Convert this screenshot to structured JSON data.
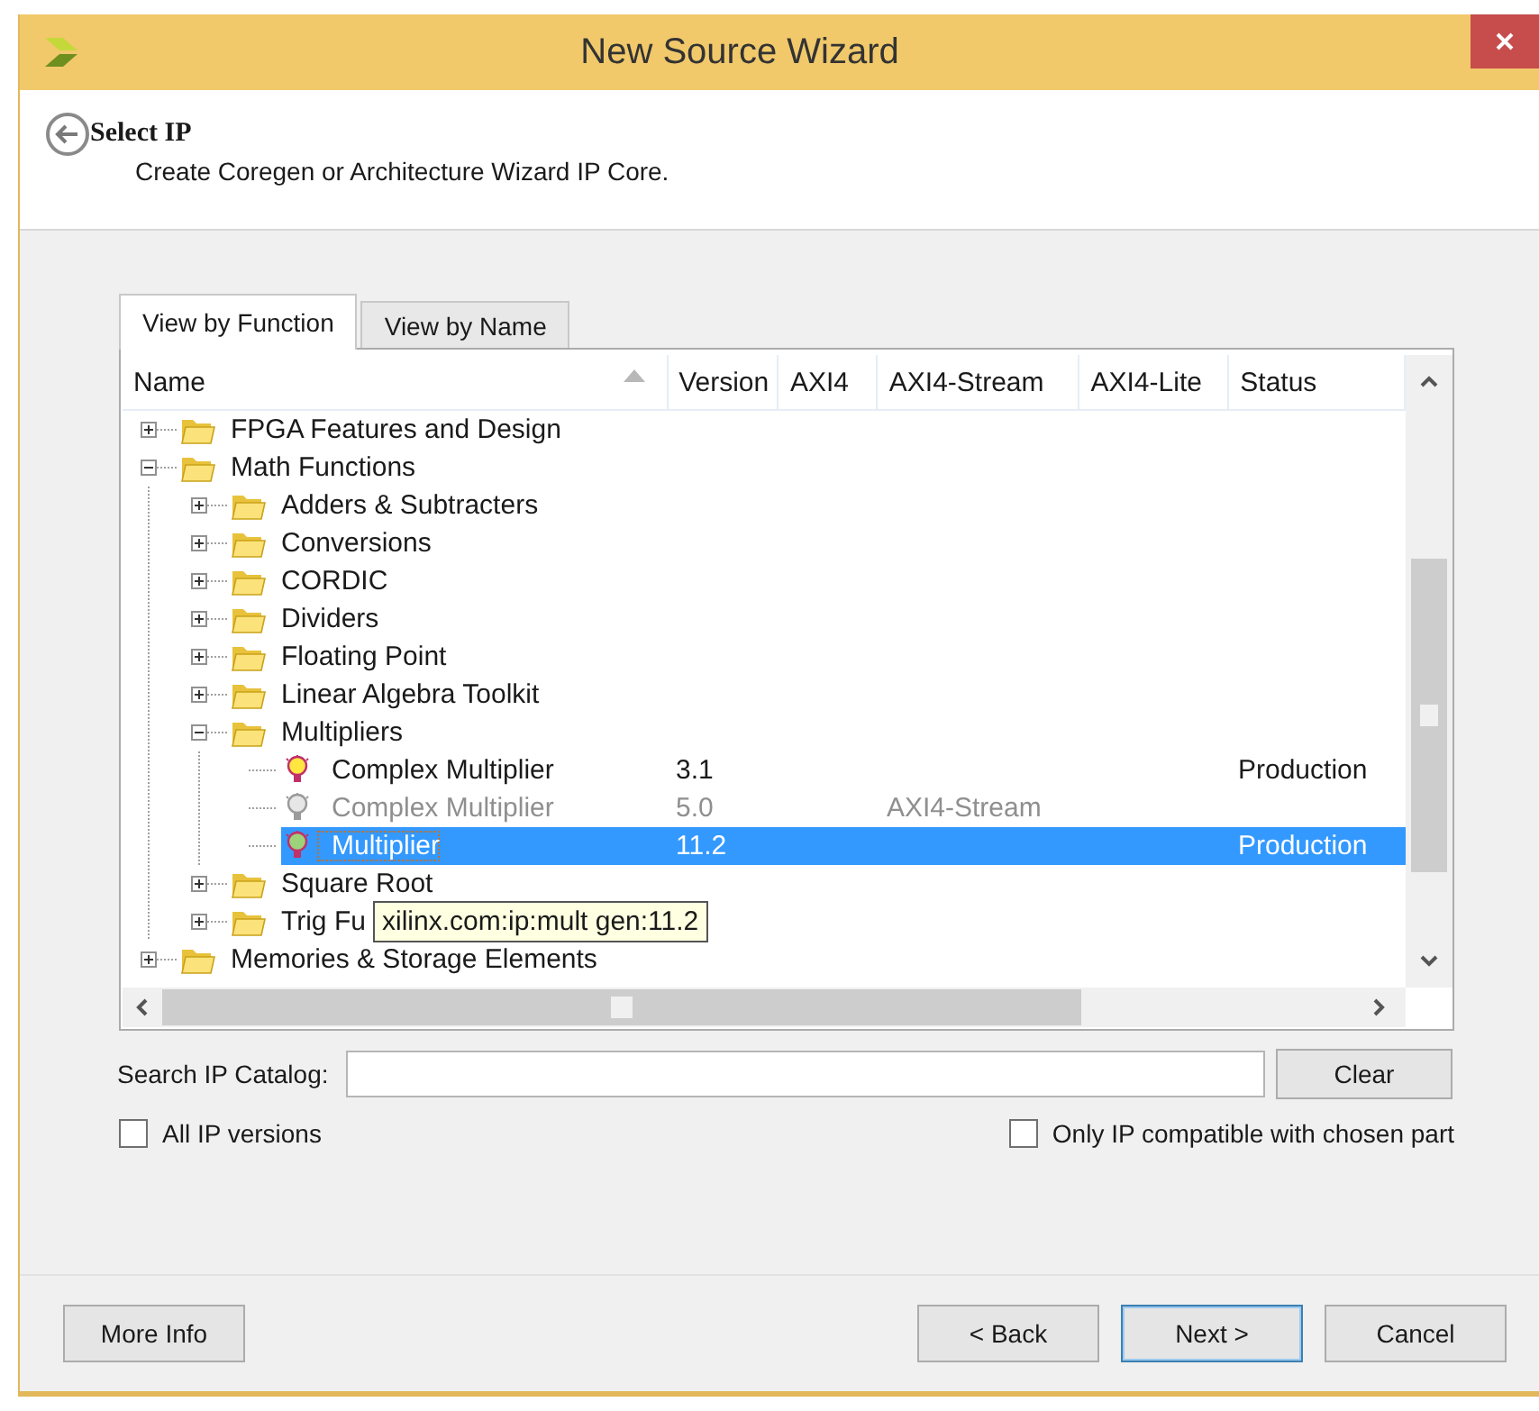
{
  "window": {
    "title": "New Source Wizard"
  },
  "header": {
    "title": "Select IP",
    "subtitle": "Create Coregen or Architecture Wizard IP Core."
  },
  "tabs": [
    {
      "label": "View by Function",
      "selected": true
    },
    {
      "label": "View by Name",
      "selected": false
    }
  ],
  "table": {
    "columns": [
      {
        "label": "Name",
        "sorted": true
      },
      {
        "label": "Version",
        "sorted": false
      },
      {
        "label": "AXI4",
        "sorted": false
      },
      {
        "label": "AXI4-Stream",
        "sorted": false
      },
      {
        "label": "AXI4-Lite",
        "sorted": false
      },
      {
        "label": "Status",
        "sorted": false
      }
    ],
    "rows": [
      {
        "label": "FPGA Features and Design",
        "kind": "folder",
        "expanded": false,
        "selected": false
      },
      {
        "label": "Math Functions",
        "kind": "folder",
        "expanded": true,
        "selected": false,
        "children": [
          {
            "label": "Adders & Subtracters",
            "kind": "folder",
            "expanded": false,
            "selected": false
          },
          {
            "label": "Conversions",
            "kind": "folder",
            "expanded": false,
            "selected": false
          },
          {
            "label": "CORDIC",
            "kind": "folder",
            "expanded": false,
            "selected": false
          },
          {
            "label": "Dividers",
            "kind": "folder",
            "expanded": false,
            "selected": false
          },
          {
            "label": "Floating Point",
            "kind": "folder",
            "expanded": false,
            "selected": false
          },
          {
            "label": "Linear Algebra Toolkit",
            "kind": "folder",
            "expanded": false,
            "selected": false
          },
          {
            "label": "Multipliers",
            "kind": "folder",
            "expanded": true,
            "selected": false,
            "children": [
              {
                "label": "Complex Multiplier",
                "kind": "core",
                "version": "3.1",
                "status": "Production",
                "disabled": false,
                "selected": false
              },
              {
                "label": "Complex Multiplier",
                "kind": "core",
                "version": "5.0",
                "axi4_stream": "AXI4-Stream",
                "disabled": true,
                "selected": false
              },
              {
                "label": "Multiplier",
                "kind": "core",
                "version": "11.2",
                "status": "Production",
                "disabled": false,
                "selected": true
              }
            ]
          },
          {
            "label": "Square Root",
            "kind": "folder",
            "expanded": false,
            "selected": false
          },
          {
            "label": "Trig Fu",
            "kind": "folder",
            "expanded": false,
            "selected": false
          }
        ]
      },
      {
        "label": "Memories & Storage Elements",
        "kind": "folder",
        "expanded": false,
        "selected": false
      }
    ],
    "tooltip": {
      "text": "xilinx.com:ip:mult gen:11.2"
    }
  },
  "search": {
    "label": "Search IP Catalog:",
    "clear": "Clear"
  },
  "options": [
    {
      "label": "All IP versions",
      "checked": false
    },
    {
      "label": "Only IP compatible with chosen part",
      "checked": false
    }
  ],
  "buttons": [
    {
      "label": "More Info",
      "default": false
    },
    {
      "label": "< Back",
      "default": false
    },
    {
      "label": "Next >",
      "default": true
    },
    {
      "label": "Cancel",
      "default": false
    }
  ]
}
